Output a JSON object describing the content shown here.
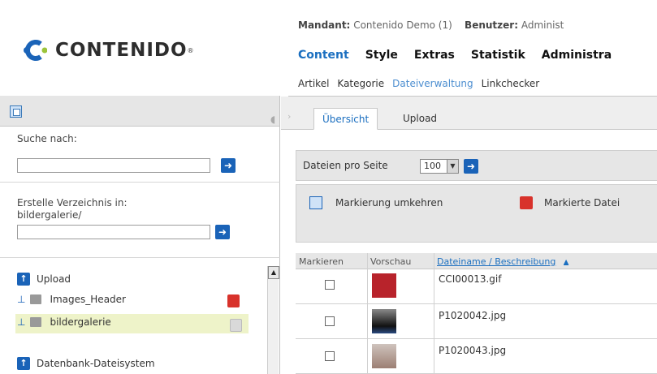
{
  "header": {
    "logo_text": "CONTENIDO",
    "mandant_label": "Mandant:",
    "mandant_value": "Contenido Demo (1)",
    "user_label": "Benutzer:",
    "user_value": "Administ",
    "main_nav": [
      "Content",
      "Style",
      "Extras",
      "Statistik",
      "Administra"
    ],
    "sub_nav": [
      "Artikel",
      "Kategorie",
      "Dateiverwaltung",
      "Linkchecker"
    ]
  },
  "sidebar": {
    "search_label": "Suche nach:",
    "search_value": "",
    "create_dir_label": "Erstelle Verzeichnis in:",
    "create_dir_path": "bildergalerie/",
    "create_dir_value": "",
    "tree": {
      "root_label": "Upload",
      "items": [
        "Images_Header",
        "bildergalerie"
      ],
      "db_label": "Datenbank-Dateisystem"
    }
  },
  "content": {
    "tabs": [
      "Übersicht",
      "Upload"
    ],
    "per_page_label": "Dateien pro Seite",
    "per_page_value": "100",
    "invert_selection_label": "Markierung umkehren",
    "delete_selected_label": "Markierte Datei",
    "table": {
      "headers": [
        "Markieren",
        "Vorschau",
        "Dateiname / Beschreibung"
      ],
      "sort_indicator": "▲",
      "rows": [
        {
          "filename": "CCI00013.gif"
        },
        {
          "filename": "P1020042.jpg"
        },
        {
          "filename": "P1020043.jpg"
        }
      ]
    }
  },
  "colors": {
    "accent_blue": "#1b6fc0",
    "button_blue": "#1a63b8",
    "selected_tree_bg": "#eef3c9",
    "delete_red": "#d8322b"
  }
}
